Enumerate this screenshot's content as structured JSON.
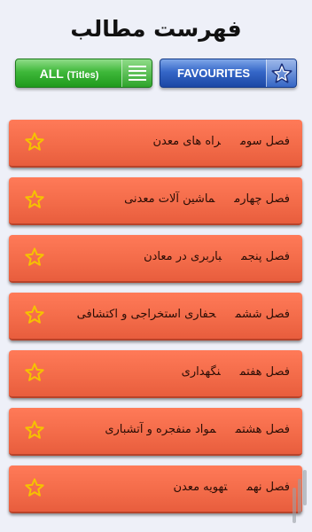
{
  "header": {
    "title": "فهرست مطالب",
    "all_button": {
      "label_main": "ALL",
      "label_sub": "(Titles)",
      "icon": "menu-icon",
      "color": "#3fb83a"
    },
    "fav_button": {
      "label": "FAVOURITES",
      "icon": "star-icon",
      "color": "#3567c8"
    }
  },
  "items": [
    {
      "chapter": "فصل سوم",
      "title": "راه های معدن"
    },
    {
      "chapter": "فصل چهارم",
      "title": "ماشین آلات معدنی"
    },
    {
      "chapter": "فصل پنجم",
      "title": "باربری در معادن"
    },
    {
      "chapter": "فصل ششم",
      "title": "حفاری استخراجی و اکتشافی"
    },
    {
      "chapter": "فصل هفتم",
      "title": "نگهداری"
    },
    {
      "chapter": "فصل هشتم",
      "title": "مواد منفجره و آتشباری"
    },
    {
      "chapter": "فصل نهم",
      "title": "تهویه معدن"
    }
  ],
  "item_star_icon": "star-outline-icon",
  "colors": {
    "item_bg": "#f26a48",
    "background": "#eef0f8",
    "star": "#f5c200"
  }
}
